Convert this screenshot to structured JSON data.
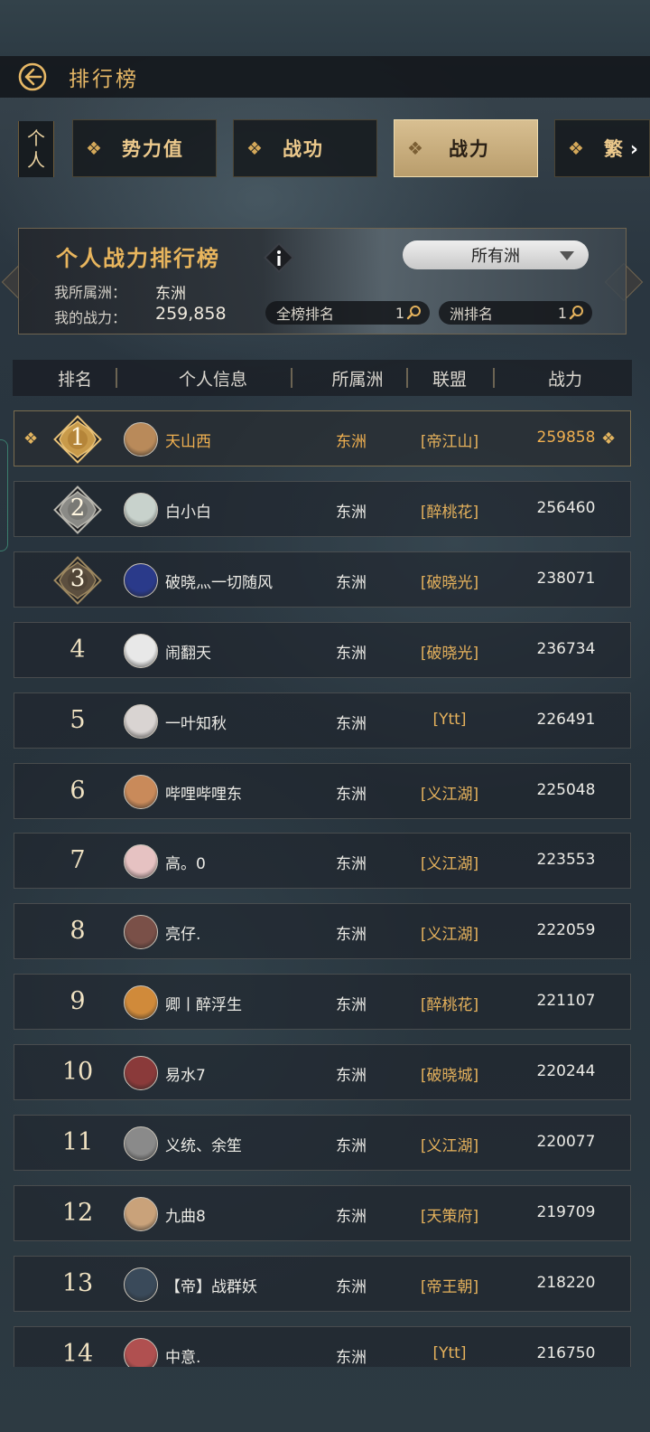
{
  "header": {
    "title": "排行榜"
  },
  "tabs": {
    "side_label_1": "个",
    "side_label_2": "人",
    "items": [
      {
        "label": "势力值"
      },
      {
        "label": "战功"
      },
      {
        "label": "战力"
      },
      {
        "label": "繁"
      }
    ],
    "active_index": 2
  },
  "banner": {
    "title": "个人战力排行榜",
    "region_select": "所有洲",
    "my_region_label": "我所属洲：",
    "my_region_value": "东洲",
    "my_power_label": "我的战力：",
    "my_power_value": "259,858",
    "global_rank_label": "全榜排名",
    "global_rank_value": "1",
    "region_rank_label": "洲排名",
    "region_rank_value": "1"
  },
  "table": {
    "headers": [
      "排名",
      "个人信息",
      "所属洲",
      "联盟",
      "战力"
    ],
    "rows": [
      {
        "rank": "1",
        "name": "天山西",
        "region": "东洲",
        "alliance": "[帝江山]",
        "power": "259858",
        "avatar_color": "#b98a5a"
      },
      {
        "rank": "2",
        "name": "白小白",
        "region": "东洲",
        "alliance": "[醉桃花]",
        "power": "256460",
        "avatar_color": "#c8d2cc"
      },
      {
        "rank": "3",
        "name": "破晓灬一切随风",
        "region": "东洲",
        "alliance": "[破晓光]",
        "power": "238071",
        "avatar_color": "#2a3a8a"
      },
      {
        "rank": "4",
        "name": "闹翻天",
        "region": "东洲",
        "alliance": "[破晓光]",
        "power": "236734",
        "avatar_color": "#e8e8e8"
      },
      {
        "rank": "5",
        "name": "一叶知秋",
        "region": "东洲",
        "alliance": "[Ytt]",
        "power": "226491",
        "avatar_color": "#d9d4d2"
      },
      {
        "rank": "6",
        "name": "哔哩哔哩东",
        "region": "东洲",
        "alliance": "[义江湖]",
        "power": "225048",
        "avatar_color": "#c98a5a"
      },
      {
        "rank": "7",
        "name": "高。0",
        "region": "东洲",
        "alliance": "[义江湖]",
        "power": "223553",
        "avatar_color": "#e6c2c2"
      },
      {
        "rank": "8",
        "name": "亮仔.",
        "region": "东洲",
        "alliance": "[义江湖]",
        "power": "222059",
        "avatar_color": "#7a5048"
      },
      {
        "rank": "9",
        "name": "卿丨醉浮生",
        "region": "东洲",
        "alliance": "[醉桃花]",
        "power": "221107",
        "avatar_color": "#d08a3a"
      },
      {
        "rank": "10",
        "name": "易水7",
        "region": "东洲",
        "alliance": "[破晓城]",
        "power": "220244",
        "avatar_color": "#8a3a3a"
      },
      {
        "rank": "11",
        "name": "义统、余笙",
        "region": "东洲",
        "alliance": "[义江湖]",
        "power": "220077",
        "avatar_color": "#8a8a8a"
      },
      {
        "rank": "12",
        "name": "九曲8",
        "region": "东洲",
        "alliance": "[天策府]",
        "power": "219709",
        "avatar_color": "#c9a27a"
      },
      {
        "rank": "13",
        "name": "【帝】战群妖",
        "region": "东洲",
        "alliance": "[帝王朝]",
        "power": "218220",
        "avatar_color": "#3a4a5a"
      },
      {
        "rank": "14",
        "name": "中意.",
        "region": "东洲",
        "alliance": "[Ytt]",
        "power": "216750",
        "avatar_color": "#b05050"
      }
    ]
  }
}
